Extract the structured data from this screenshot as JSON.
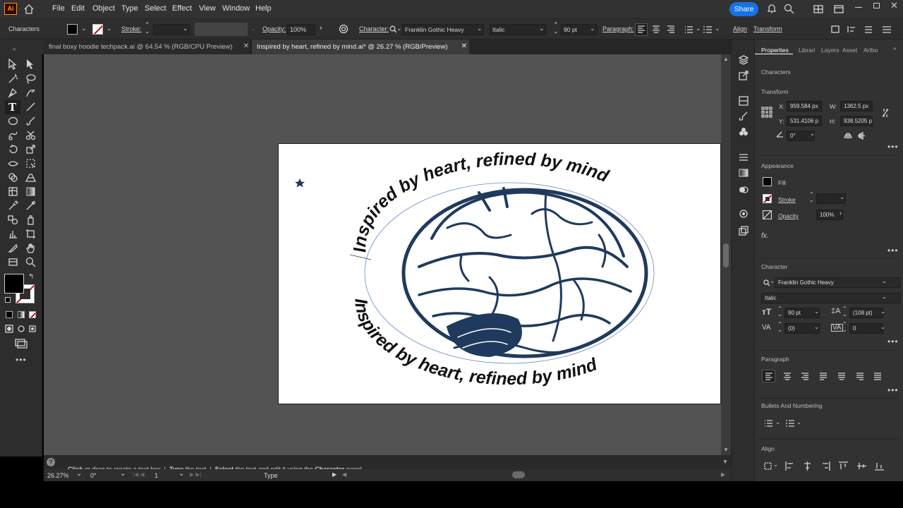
{
  "app": {
    "logo": "Ai"
  },
  "menu": [
    "File",
    "Edit",
    "Object",
    "Type",
    "Select",
    "Effect",
    "View",
    "Window",
    "Help"
  ],
  "share_label": "Share",
  "control": {
    "context": "Characters",
    "stroke_label": "Stroke:",
    "opacity_label": "Opacity:",
    "opacity_value": "100%",
    "character_label": "Character:",
    "font_name": "Franklin Gothic Heavy",
    "font_style": "Italic",
    "font_size": "90 pt",
    "paragraph_label": "Paragraph:",
    "align_label": "Align",
    "transform_label": "Transform"
  },
  "tabs": [
    {
      "label": "final boxy hoodie techpack.ai @ 64.54 % (RGB/CPU Preview)",
      "active": false
    },
    {
      "label": "Inspired by heart, refined by mind.ai* @ 26.27 % (RGB/Preview)",
      "active": true
    }
  ],
  "artwork": {
    "text_top": "Inspired by heart, refined by mind",
    "text_bottom": "Inspired by heart, refined by mind",
    "text_color": "#111111",
    "brain_color": "#1f3a5c"
  },
  "status": {
    "hint_parts": [
      {
        "bold": "Click",
        "rest": " or drag to create a text box  |  "
      },
      {
        "bold": "Type",
        "rest": " the text  |  "
      },
      {
        "bold": "Select",
        "rest": " the text and edit it using the "
      },
      {
        "bold": "Character",
        "rest": " panel"
      }
    ],
    "zoom": "26.27%",
    "rotation": "0°",
    "artboard_num": "1",
    "tool_name": "Type"
  },
  "panel": {
    "tabs": [
      "Properties",
      "Librari",
      "Layers",
      "Asset",
      "Artbo"
    ],
    "selection_type": "Characters",
    "transform_title": "Transform",
    "x_label": "X:",
    "x_value": "959.584 px",
    "y_label": "Y:",
    "y_value": "531.4106 p",
    "w_label": "W:",
    "w_value": "1362.5 px",
    "h_label": "H:",
    "h_value": "938.5205 p",
    "angle_value": "0°",
    "appearance_title": "Appearance",
    "fill_label": "Fill",
    "stroke_label": "Stroke",
    "opacity_label": "Opacity",
    "opacity_value": "100%",
    "fx_label": "fx.",
    "character_title": "Character",
    "font_name": "Franklin Gothic Heavy",
    "font_style": "Italic",
    "font_size": "90 pt",
    "leading": "(108 pt)",
    "kerning": "(0)",
    "tracking": "0",
    "paragraph_title": "Paragraph",
    "bullets_title": "Bullets And Numbering",
    "align_title": "Align"
  },
  "colors": {
    "accent": "#1473e6",
    "stroke_none": "#d0021b"
  }
}
